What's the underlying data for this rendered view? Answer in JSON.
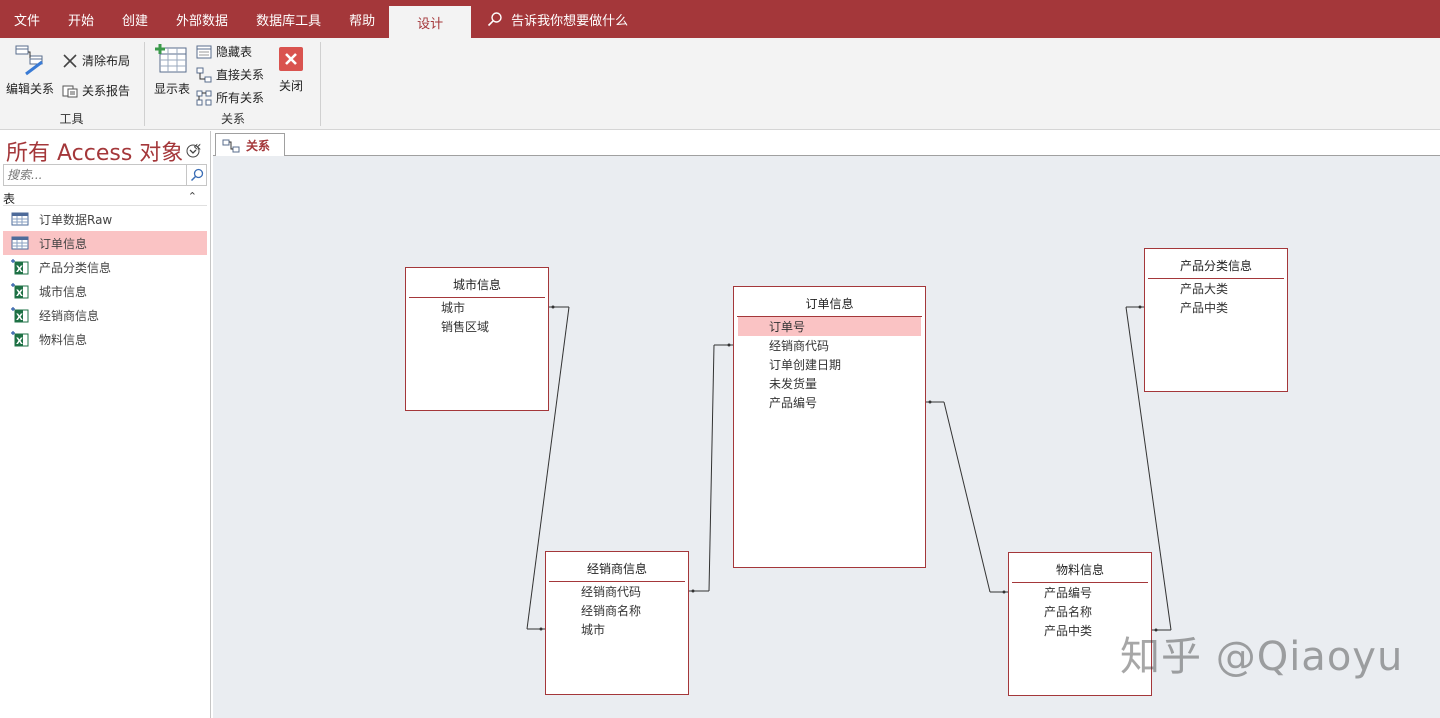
{
  "menu": {
    "tabs": [
      "文件",
      "开始",
      "创建",
      "外部数据",
      "数据库工具",
      "帮助",
      "设计"
    ],
    "active_tab": "设计",
    "tell_me": "告诉我你想要做什么"
  },
  "ribbon": {
    "tools": {
      "label": "工具",
      "edit_relationships": "编辑关系",
      "clear_layout": "清除布局",
      "relationship_report": "关系报告"
    },
    "relationships": {
      "label": "关系",
      "show_table": "显示表",
      "hide_table": "隐藏表",
      "direct_relationships": "直接关系",
      "all_relationships": "所有关系",
      "close": "关闭"
    }
  },
  "nav": {
    "title": "所有 Access 对象",
    "search_placeholder": "搜索...",
    "section": "表",
    "items": [
      {
        "label": "订单数据Raw",
        "icon": "table-icon",
        "selected": false
      },
      {
        "label": "订单信息",
        "icon": "table-icon",
        "selected": true
      },
      {
        "label": "产品分类信息",
        "icon": "excel-linked-table-icon",
        "selected": false
      },
      {
        "label": "城市信息",
        "icon": "excel-linked-table-icon",
        "selected": false
      },
      {
        "label": "经销商信息",
        "icon": "excel-linked-table-icon",
        "selected": false
      },
      {
        "label": "物料信息",
        "icon": "excel-linked-table-icon",
        "selected": false
      }
    ]
  },
  "document_tab": "关系",
  "tables": {
    "city": {
      "title": "城市信息",
      "fields": [
        "城市",
        "销售区域"
      ]
    },
    "order": {
      "title": "订单信息",
      "fields": [
        "订单号",
        "经销商代码",
        "订单创建日期",
        "未发货量",
        "产品编号"
      ],
      "selected_field": "订单号"
    },
    "category": {
      "title": "产品分类信息",
      "fields": [
        "产品大类",
        "产品中类"
      ]
    },
    "dealer": {
      "title": "经销商信息",
      "fields": [
        "经销商代码",
        "经销商名称",
        "城市"
      ]
    },
    "material": {
      "title": "物料信息",
      "fields": [
        "产品编号",
        "产品名称",
        "产品中类"
      ]
    }
  },
  "relationships": [
    {
      "from": "城市信息.城市",
      "to": "经销商信息.城市"
    },
    {
      "from": "经销商信息.经销商代码",
      "to": "订单信息.经销商代码"
    },
    {
      "from": "订单信息.产品编号",
      "to": "物料信息.产品编号"
    },
    {
      "from": "物料信息.产品中类",
      "to": "产品分类信息.产品中类"
    }
  ],
  "colors": {
    "accent": "#a4373a",
    "selection": "#fac3c4",
    "canvas": "#eaedf1"
  },
  "watermark": "知乎 @Qiaoyu"
}
